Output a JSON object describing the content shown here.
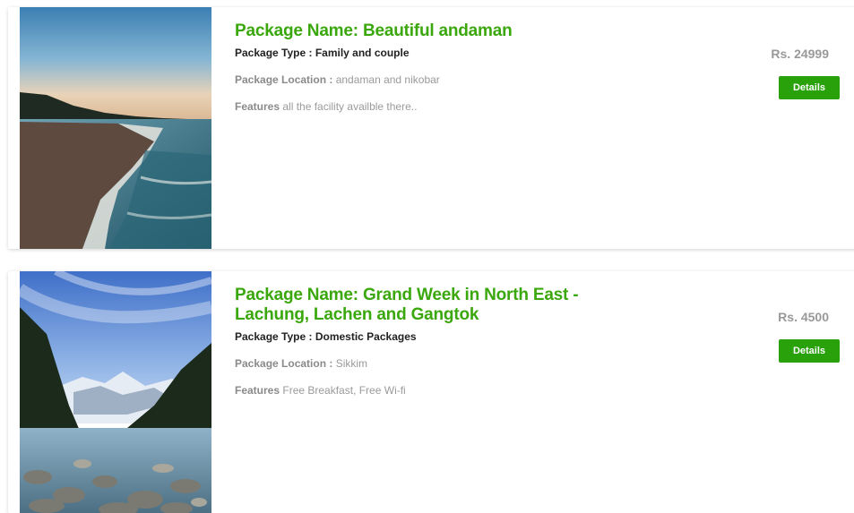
{
  "packages": [
    {
      "title": "Package Name: Beautiful andaman",
      "type_label": "Package Type : ",
      "type_value": "Family and couple",
      "location_label": "Package Location : ",
      "location_value": "andaman and nikobar",
      "features_label": "Features",
      "features_value": " all the facility availble there..",
      "price": "Rs. 24999",
      "button_label": "Details"
    },
    {
      "title": "Package Name: Grand Week in North East - Lachung, Lachen and Gangtok",
      "type_label": "Package Type : ",
      "type_value": "Domestic Packages",
      "location_label": "Package Location : ",
      "location_value": "Sikkim",
      "features_label": "Features",
      "features_value": " Free Breakfast, Free Wi-fi",
      "price": "Rs. 4500",
      "button_label": "Details"
    }
  ],
  "colors": {
    "accent": "#3aa70c",
    "button": "#28a10b",
    "price": "#999999"
  }
}
